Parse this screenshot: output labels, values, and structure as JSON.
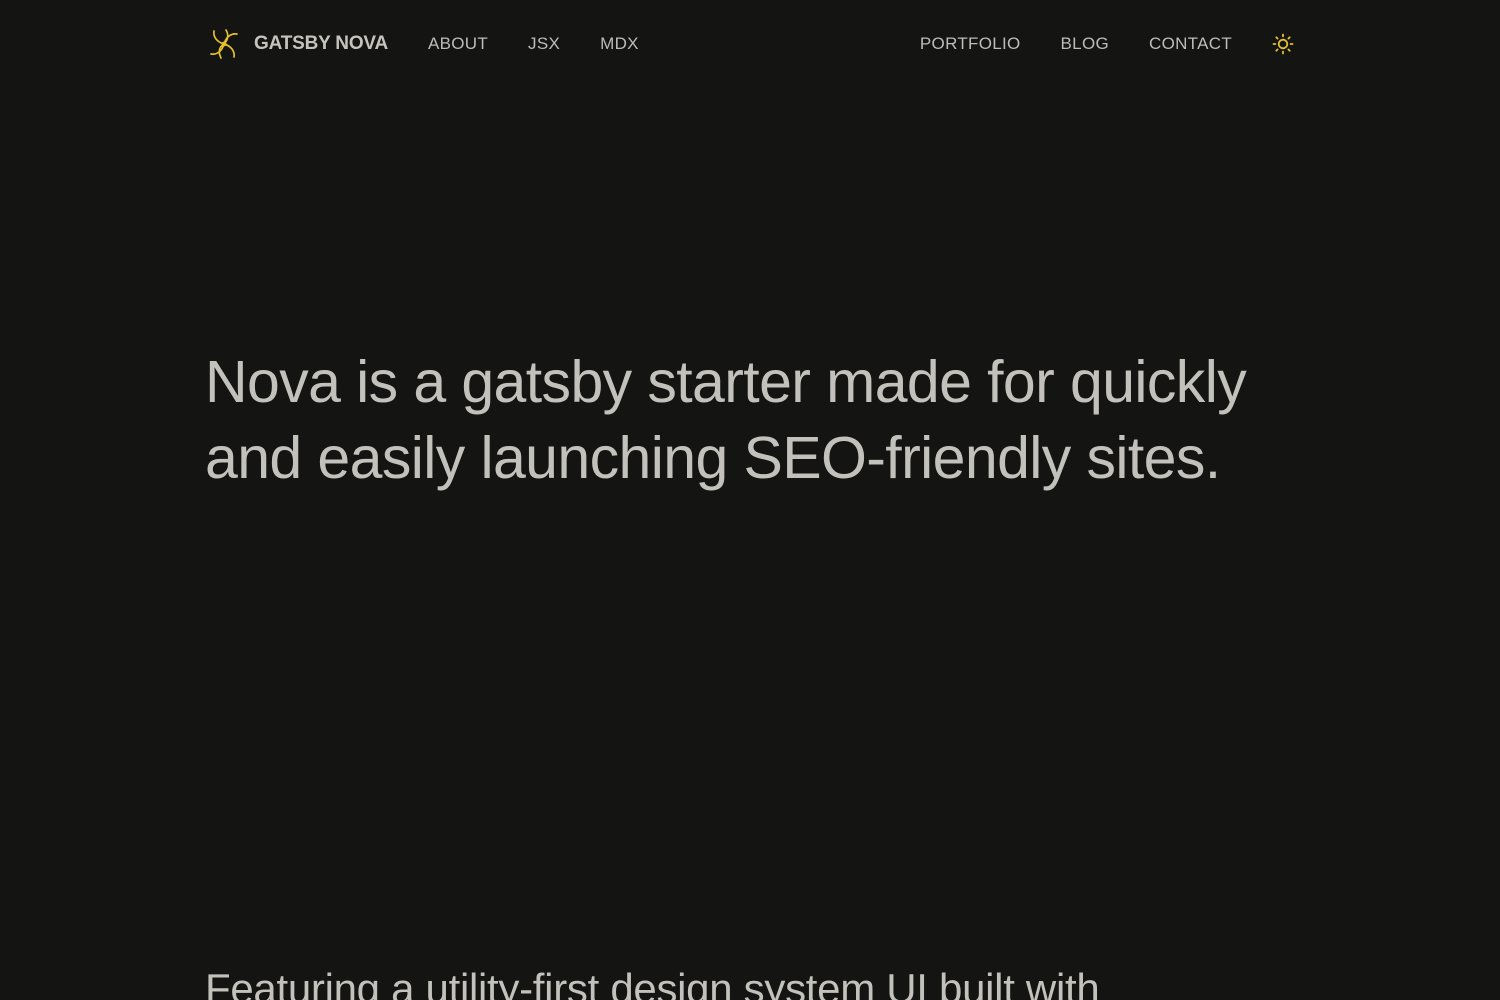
{
  "navbar": {
    "brand": {
      "logo_icon": "nova-swirl-logo-icon",
      "name": "GATSBY NOVA"
    },
    "left_links": [
      {
        "label": "ABOUT"
      },
      {
        "label": "JSX"
      },
      {
        "label": "MDX"
      }
    ],
    "right_links": [
      {
        "label": "PORTFOLIO"
      },
      {
        "label": "BLOG"
      },
      {
        "label": "CONTACT"
      }
    ],
    "theme_toggle_icon": "sun-icon"
  },
  "hero": {
    "headline": "Nova is a gatsby starter made for quickly and easily launching SEO-friendly sites."
  },
  "feature": {
    "text": "Featuring a utility-first design system UI built with"
  },
  "colors": {
    "background": "#141413",
    "text": "#c2c1bb",
    "accent": "#e5c12a"
  }
}
